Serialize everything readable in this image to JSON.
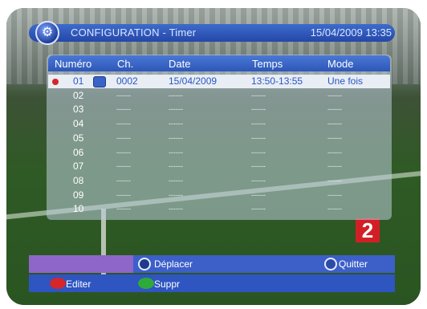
{
  "header": {
    "title": "CONFIGURATION - Timer",
    "datetime": "15/04/2009  13:35"
  },
  "columns": [
    "Numéro",
    "Ch.",
    "Date",
    "Temps",
    "Mode"
  ],
  "rows": [
    {
      "num": "01",
      "ch": "0002",
      "date": "15/04/2009",
      "time": "13:50-13:55",
      "mode": "Une fois",
      "selected": true
    },
    {
      "num": "02",
      "ch": "------",
      "date": "------",
      "time": "------",
      "mode": "------"
    },
    {
      "num": "03",
      "ch": "------",
      "date": "------",
      "time": "------",
      "mode": "------"
    },
    {
      "num": "04",
      "ch": "------",
      "date": "------",
      "time": "------",
      "mode": "------"
    },
    {
      "num": "05",
      "ch": "------",
      "date": "------",
      "time": "------",
      "mode": "------"
    },
    {
      "num": "06",
      "ch": "------",
      "date": "------",
      "time": "------",
      "mode": "------"
    },
    {
      "num": "07",
      "ch": "------",
      "date": "------",
      "time": "------",
      "mode": "------"
    },
    {
      "num": "08",
      "ch": "------",
      "date": "------",
      "time": "------",
      "mode": "------"
    },
    {
      "num": "09",
      "ch": "------",
      "date": "------",
      "time": "------",
      "mode": "------"
    },
    {
      "num": "10",
      "ch": "------",
      "date": "------",
      "time": "------",
      "mode": "------"
    }
  ],
  "footer": {
    "move_label": "Déplacer",
    "quit_label": "Quitter",
    "edit_label": "Editer",
    "delete_label": "Suppr"
  },
  "channel_logo": "2",
  "icons": {
    "title": "configuration-icon",
    "move": "navigation-icon",
    "quit": "exit-icon"
  },
  "colors": {
    "header_blue": "#2d57b8",
    "selected_text": "#2a55c4",
    "record_red": "#d4262b",
    "green_button": "#2faa3a",
    "red_button": "#d4262b"
  }
}
